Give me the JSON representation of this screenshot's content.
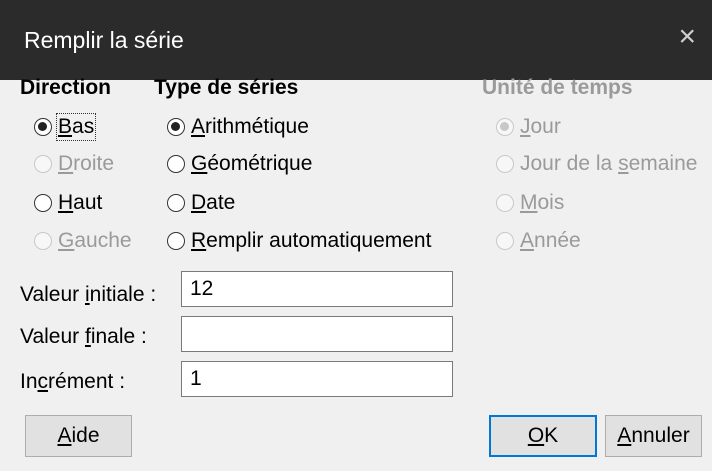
{
  "dialog": {
    "title": "Remplir la série",
    "close_glyph": "×"
  },
  "direction": {
    "header": "Direction",
    "options": [
      {
        "pre": "",
        "key": "B",
        "post": "as",
        "checked": true,
        "enabled": true
      },
      {
        "pre": "",
        "key": "D",
        "post": "roite",
        "checked": false,
        "enabled": false
      },
      {
        "pre": "",
        "key": "H",
        "post": "aut",
        "checked": false,
        "enabled": true
      },
      {
        "pre": "",
        "key": "G",
        "post": "auche",
        "checked": false,
        "enabled": false
      }
    ]
  },
  "series_type": {
    "header": "Type de séries",
    "options": [
      {
        "pre": "",
        "key": "A",
        "post": "rithmétique",
        "checked": true,
        "enabled": true
      },
      {
        "pre": "",
        "key": "G",
        "post": "éométrique",
        "checked": false,
        "enabled": true
      },
      {
        "pre": "",
        "key": "D",
        "post": "ate",
        "checked": false,
        "enabled": true
      },
      {
        "pre": "",
        "key": "R",
        "post": "emplir automatiquement",
        "checked": false,
        "enabled": true
      }
    ]
  },
  "time_unit": {
    "header": "Unité de temps",
    "options": [
      {
        "pre": "",
        "key": "J",
        "post": "our",
        "checked": true,
        "enabled": false
      },
      {
        "pre": "Jour de la ",
        "key": "s",
        "post": "emaine",
        "checked": false,
        "enabled": false
      },
      {
        "pre": "",
        "key": "M",
        "post": "ois",
        "checked": false,
        "enabled": false
      },
      {
        "pre": "",
        "key": "A",
        "post": "nnée",
        "checked": false,
        "enabled": false
      }
    ]
  },
  "fields": {
    "start": {
      "pre": "Valeur ",
      "key": "i",
      "post": "nitiale :",
      "value": "12"
    },
    "end": {
      "pre": "Valeur ",
      "key": "f",
      "post": "inale :",
      "value": ""
    },
    "increment": {
      "pre": "In",
      "key": "c",
      "post": "rément :",
      "value": "1"
    }
  },
  "buttons": {
    "help": {
      "pre": "",
      "key": "A",
      "post": "ide"
    },
    "ok": {
      "pre": "",
      "key": "O",
      "post": "K"
    },
    "cancel": {
      "pre": "",
      "key": "A",
      "post": "nnuler"
    }
  }
}
